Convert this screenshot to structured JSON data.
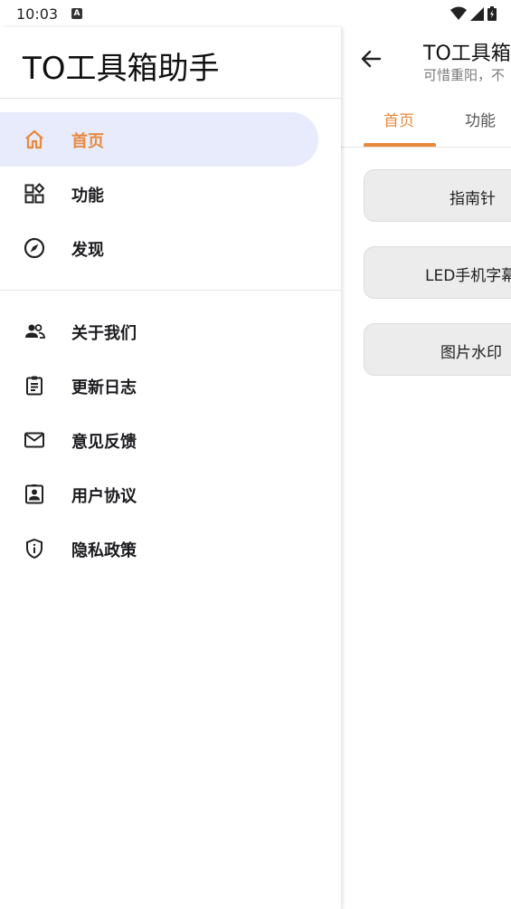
{
  "status_bar": {
    "time": "10:03",
    "notification_letter": "A"
  },
  "main": {
    "title": "TO工具箱助手",
    "subtitle": "可惜重阳，不",
    "tabs": [
      {
        "label": "首页",
        "active": true
      },
      {
        "label": "功能",
        "active": false
      }
    ],
    "tools": [
      {
        "label": "指南针"
      },
      {
        "label": "LED手机字幕"
      },
      {
        "label": "图片水印"
      }
    ]
  },
  "drawer": {
    "title": "TO工具箱助手",
    "group1": [
      {
        "label": "首页",
        "icon": "home-icon",
        "active": true
      },
      {
        "label": "功能",
        "icon": "widgets-icon",
        "active": false
      },
      {
        "label": "发现",
        "icon": "compass-icon",
        "active": false
      }
    ],
    "group2": [
      {
        "label": "关于我们",
        "icon": "people-icon"
      },
      {
        "label": "更新日志",
        "icon": "clipboard-icon"
      },
      {
        "label": "意见反馈",
        "icon": "mail-icon"
      },
      {
        "label": "用户协议",
        "icon": "badge-icon"
      },
      {
        "label": "隐私政策",
        "icon": "shield-info-icon"
      }
    ]
  },
  "colors": {
    "accent": "#e8893d",
    "active_bg": "#e7ebfb",
    "button_bg": "#ececec"
  }
}
